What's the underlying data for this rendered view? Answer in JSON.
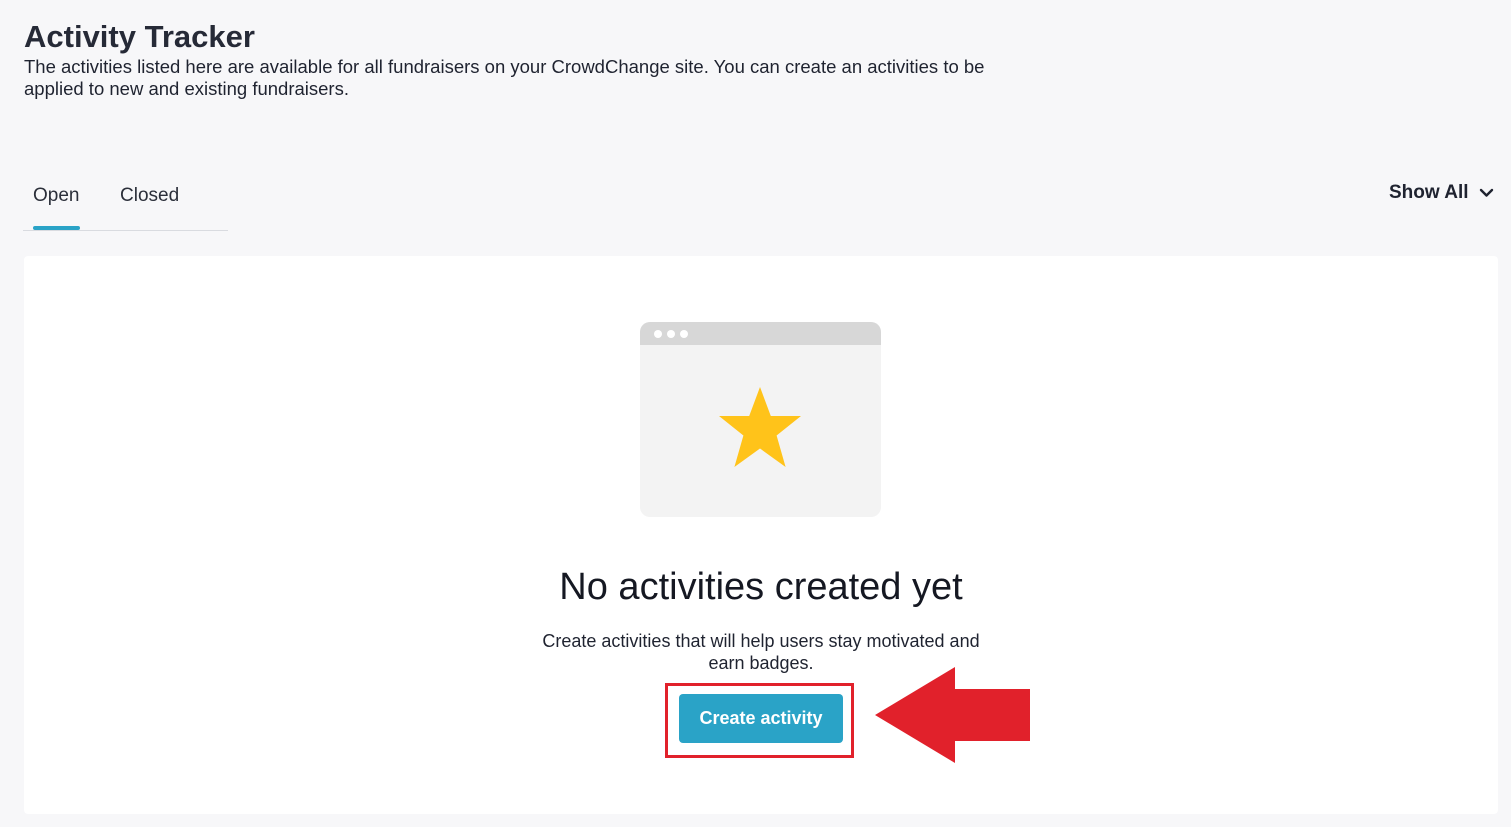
{
  "header": {
    "title": "Activity Tracker",
    "description": "The activities listed here are available for all fundraisers on your CrowdChange site. You can create an activities to be applied to new and existing fundraisers."
  },
  "tabs": [
    {
      "label": "Open",
      "active": true
    },
    {
      "label": "Closed",
      "active": false
    }
  ],
  "filter": {
    "label": "Show All",
    "icon": "chevron-down-icon"
  },
  "empty_state": {
    "illustration_icons": [
      "browser-window-icon",
      "star-icon"
    ],
    "title": "No activities created yet",
    "description": "Create activities that will help users stay motivated and earn badges.",
    "button_label": "Create activity"
  },
  "annotation": {
    "highlight_color": "#e1212b",
    "arrow_icon": "left-arrow-icon"
  },
  "colors": {
    "accent": "#2aa3c7",
    "star": "#ffc31a",
    "highlight": "#e1212b"
  }
}
